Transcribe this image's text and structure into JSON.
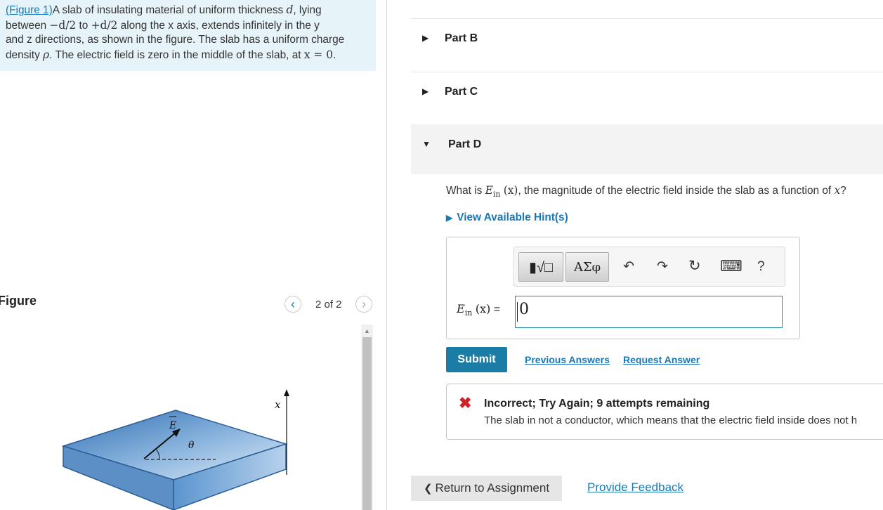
{
  "intro": {
    "figure_link": "(Figure 1)",
    "line1": "A slab of insulating material of uniform thickness",
    "sym_d": "d",
    "lying": ", lying",
    "between": "between",
    "neg_half": "−d/2",
    "to": "to",
    "pos_half": "+d/2",
    "along": "along the x axis, extends infinitely in the y",
    "line3": "and z directions, as shown in the figure. The slab has a uniform charge",
    "density": "density",
    "rho": "ρ",
    "line4": ". The electric field is zero in the middle of the slab, at",
    "x_eq": "x = 0",
    "period": "."
  },
  "figure": {
    "title": "Figure",
    "prev_icon": "‹",
    "next_icon": "›",
    "pager": "2 of 2",
    "label_x": "x",
    "label_E": "E",
    "label_theta": "θ"
  },
  "parts": [
    {
      "label": "Part B",
      "state": "collapsed",
      "caret": "▶"
    },
    {
      "label": "Part C",
      "state": "collapsed",
      "caret": "▶"
    },
    {
      "label": "Part D",
      "state": "expanded",
      "caret": "▼"
    }
  ],
  "part_d": {
    "question_pre": "What is",
    "question_sym": "E",
    "question_sub": "in",
    "question_arg": "(x)",
    "question_post": ", the magnitude of the electric field inside the slab as a function of",
    "question_x": "x",
    "question_end": "?",
    "hint_caret": "▶",
    "hint_label": "View Available Hint(s)",
    "toolbar": {
      "template_label": "▮√□",
      "greek_label": "ΑΣφ",
      "undo_icon": "↶",
      "redo_icon": "↷",
      "reset_icon": "↻",
      "keyboard_icon": "⌨",
      "help_icon": "?"
    },
    "answer_label_sym": "E",
    "answer_label_sub": "in",
    "answer_label_arg": "(x)",
    "answer_label_eq": "=",
    "answer_value": "0",
    "submit_label": "Submit",
    "previous_answers": "Previous Answers",
    "request_answer": "Request Answer"
  },
  "feedback": {
    "icon": "✖",
    "title": "Incorrect; Try Again; 9 attempts remaining",
    "text": "The slab in not a conductor, which means that the electric field inside does not h"
  },
  "footer": {
    "return_label": "Return to Assignment",
    "return_icon": "❮",
    "provide_feedback": "Provide Feedback"
  },
  "colors": {
    "link": "#1a79b5",
    "submit": "#1b7da6",
    "error": "#d0202a",
    "intro_bg": "#e6f3f8",
    "slab": "#4a88c7"
  }
}
